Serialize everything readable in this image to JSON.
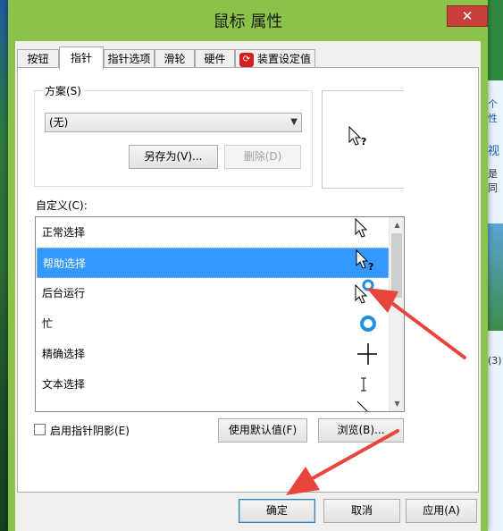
{
  "window": {
    "title": "鼠标 属性",
    "close_symbol": "✕"
  },
  "tabs": [
    {
      "label": "按钮"
    },
    {
      "label": "指针"
    },
    {
      "label": "指针选项"
    },
    {
      "label": "滑轮"
    },
    {
      "label": "硬件"
    },
    {
      "label": "装置设定值",
      "icon": "device-settings-icon"
    }
  ],
  "active_tab": "指针",
  "scheme": {
    "group_label": "方案(S)",
    "selected": "(无)",
    "save_as_label": "另存为(V)...",
    "delete_label": "删除(D)"
  },
  "custom_label": "自定义(C):",
  "pointer_list": [
    {
      "label": "正常选择",
      "cursor": "arrow-cursor-icon"
    },
    {
      "label": "帮助选择",
      "cursor": "help-cursor-icon",
      "selected": true
    },
    {
      "label": "后台运行",
      "cursor": "working-cursor-icon"
    },
    {
      "label": "忙",
      "cursor": "busy-cursor-icon"
    },
    {
      "label": "精确选择",
      "cursor": "crosshair-cursor-icon"
    },
    {
      "label": "文本选择",
      "cursor": "text-cursor-icon"
    }
  ],
  "shadow_checkbox": {
    "label": "启用指针阴影(E)",
    "checked": false
  },
  "use_default_label": "使用默认值(F)",
  "browse_label": "浏览(B)...",
  "footer": {
    "ok_label": "确定",
    "cancel_label": "取消",
    "apply_label": "应用(A)"
  },
  "background_fragments": [
    "视",
    "是同",
    "个性",
    "(3)"
  ],
  "colors": {
    "window_frame": "#8bc24a",
    "selection": "#3399ff",
    "annotation_arrow": "#e8463c",
    "close_button": "#c7413a"
  }
}
